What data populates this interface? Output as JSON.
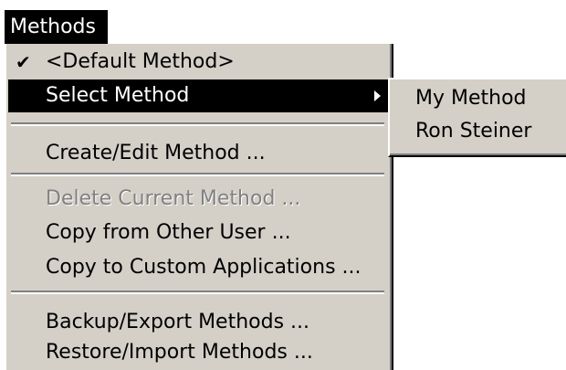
{
  "menubar": {
    "title": "Methods"
  },
  "menu": {
    "items": [
      {
        "label": "<Default Method>",
        "checked": true
      },
      {
        "label": "Select Method",
        "submenu": true,
        "highlighted": true
      },
      {
        "label": "Create/Edit Method ..."
      },
      {
        "label": "Delete Current Method ...",
        "disabled": true
      },
      {
        "label": "Copy from Other User ..."
      },
      {
        "label": "Copy to Custom Applications ..."
      },
      {
        "label": "Backup/Export Methods ..."
      },
      {
        "label": "Restore/Import Methods ..."
      }
    ]
  },
  "submenu": {
    "items": [
      {
        "label": "My Method"
      },
      {
        "label": "Ron Steiner"
      }
    ]
  },
  "icons": {
    "check": "checkmark-icon",
    "submenu_arrow": "submenu-arrow-icon"
  },
  "colors": {
    "menu_bg": "#d4d0c8",
    "highlight_bg": "#000000",
    "highlight_fg": "#ffffff",
    "disabled_fg": "#808080"
  }
}
